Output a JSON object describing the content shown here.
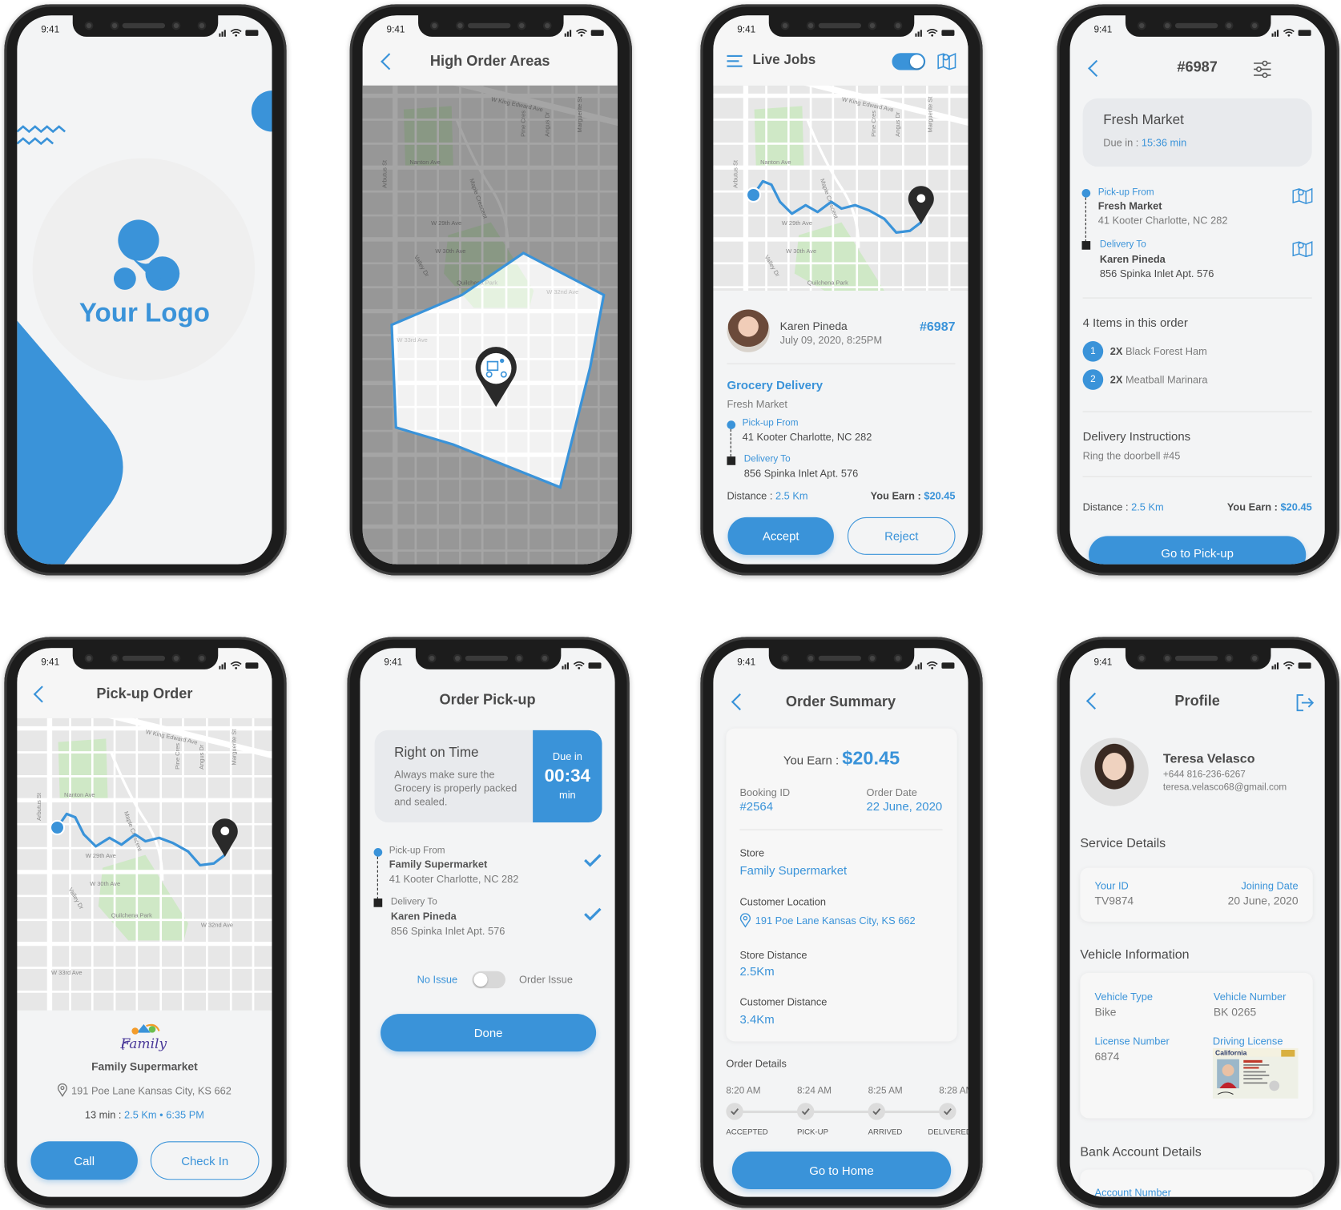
{
  "status": {
    "time": "9:41"
  },
  "colors": {
    "accent": "#3a93d9",
    "text": "#4a4a4a",
    "frame": "#1c1c1c",
    "park": "#cfe8c6",
    "map_bg": "#e7e7e7"
  },
  "maps": {
    "labels": [
      "W King Edward Ave",
      "Nanton Ave",
      "W 29th Ave",
      "W 30th Ave",
      "Quilchena Park",
      "W 32nd Ave",
      "W 33rd Ave",
      "Arbutus St",
      "Maple Crescent",
      "Pine Cres",
      "Angus Dr",
      "Marguerite St",
      "Valley Dr"
    ]
  },
  "splash": {
    "logo_text": "Your Logo"
  },
  "high_order_areas": {
    "title": "High Order Areas",
    "pin_icon": "courier-pin-icon"
  },
  "live_jobs": {
    "title": "Live Jobs",
    "online": true,
    "customer_name": "Karen Pineda",
    "datetime": "July 09, 2020, 8:25PM",
    "order_id": "#6987",
    "type": "Grocery Delivery",
    "store": "Fresh Market",
    "pickup_label": "Pick-up From",
    "pickup_address": "41 Kooter Charlotte, NC 282",
    "delivery_label": "Delivery To",
    "delivery_address": "856 Spinka Inlet Apt. 576",
    "distance_label": "Distance : ",
    "distance": "2.5 Km",
    "earn_label": "You Earn : ",
    "earn": "$20.45",
    "accept": "Accept",
    "reject": "Reject"
  },
  "order_detail": {
    "title": "#6987",
    "store": "Fresh Market",
    "due_label": "Due in : ",
    "due": "15:36 min",
    "pickup_label": "Pick-up From",
    "pickup_name": "Fresh Market",
    "pickup_address": "41 Kooter Charlotte, NC 282",
    "delivery_label": "Delivery To",
    "delivery_name": "Karen Pineda",
    "delivery_address": "856 Spinka Inlet Apt. 576",
    "items_title": "4 Items in this order",
    "items": [
      {
        "num": "1",
        "qty": "2X",
        "name": "Black Forest Ham"
      },
      {
        "num": "2",
        "qty": "2X",
        "name": "Meatball Marinara"
      }
    ],
    "instructions_title": "Delivery Instructions",
    "instructions": "Ring the doorbell #45",
    "distance_label": "Distance : ",
    "distance": "2.5 Km",
    "earn_label": "You Earn : ",
    "earn": "$20.45",
    "button": "Go to Pick-up"
  },
  "pickup_order": {
    "title": "Pick-up Order",
    "logo_text": "Family",
    "store": "Family Supermarket",
    "address": "191 Poe Lane Kansas City, KS 662",
    "eta_label": "13 min : ",
    "distance": "2.5 Km",
    "bullet": "•",
    "time": "6:35 PM",
    "call": "Call",
    "check_in": "Check In"
  },
  "order_pickup": {
    "title": "Order Pick-up",
    "card_title": "Right on Time",
    "card_text": [
      "Always make sure the",
      "Grocery is properly packed",
      "and sealed."
    ],
    "due_label": "Due in",
    "due": "00:34",
    "due_unit": "min",
    "pickup_label": "Pick-up From",
    "pickup_name": "Family Supermarket",
    "pickup_address": "41 Kooter Charlotte, NC 282",
    "delivery_label": "Delivery To",
    "delivery_name": "Karen Pineda",
    "delivery_address": "856 Spinka Inlet Apt. 576",
    "no_issue": "No Issue",
    "order_issue": "Order Issue",
    "issue_toggle": false,
    "done": "Done"
  },
  "order_summary": {
    "title": "Order Summary",
    "earn_label": "You Earn : ",
    "earn": "$20.45",
    "booking_label": "Booking ID",
    "booking_id": "#2564",
    "date_label": "Order Date",
    "date": "22 June, 2020",
    "store_label": "Store",
    "store": "Family Supermarket",
    "location_label": "Customer Location",
    "location": "191 Poe Lane Kansas City, KS 662",
    "store_distance_label": "Store Distance",
    "store_distance": "2.5Km",
    "customer_distance_label": "Customer Distance",
    "customer_distance": "3.4Km",
    "details_label": "Order Details",
    "timeline": [
      {
        "time": "8:20 AM",
        "label": "ACCEPTED"
      },
      {
        "time": "8:24 AM",
        "label": "PICK-UP"
      },
      {
        "time": "8:25 AM",
        "label": "ARRIVED"
      },
      {
        "time": "8:28 AM",
        "label": "DELIVERED"
      }
    ],
    "button": "Go to Home"
  },
  "profile": {
    "title": "Profile",
    "name": "Teresa Velasco",
    "phone": "+644 816-236-6267",
    "email": "teresa.velasco68@gmail.com",
    "service_title": "Service Details",
    "id_label": "Your ID",
    "id": "TV9874",
    "joining_label": "Joining Date",
    "joining": "20 June, 2020",
    "vehicle_title": "Vehicle Information",
    "vehicle_type_label": "Vehicle Type",
    "vehicle_type": "Bike",
    "vehicle_number_label": "Vehicle Number",
    "vehicle_number": "BK 0265",
    "license_number_label": "License Number",
    "license_number": "6874",
    "driving_license_label": "Driving License",
    "license_card_text": "California",
    "bank_title": "Bank Account Details",
    "account_label": "Account Number"
  }
}
